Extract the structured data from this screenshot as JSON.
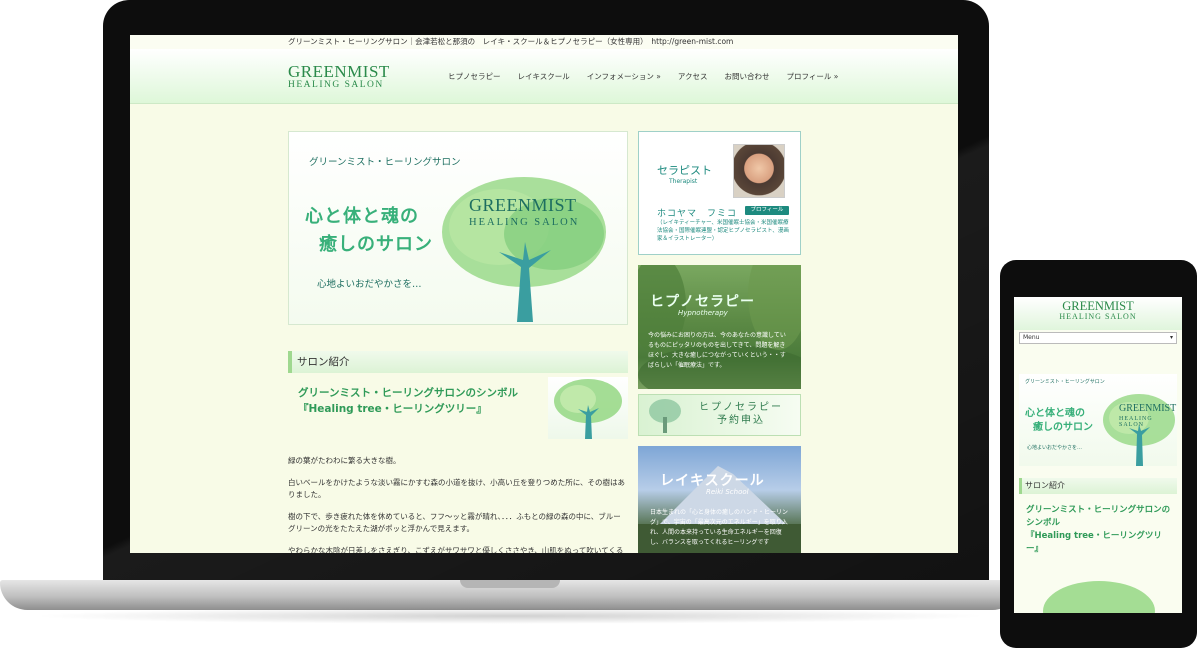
{
  "site": {
    "topline": "グリーンミスト・ヒーリングサロン｜会津若松と那須の　レイキ・スクール＆ヒプノセラピー（女性専用）　http://green-mist.com",
    "logo": {
      "line1": "GREENMIST",
      "line2": "HEALING   SALON"
    },
    "nav": [
      {
        "label": "ヒプノセラピー",
        "dropdown": false
      },
      {
        "label": "レイキスクール",
        "dropdown": false
      },
      {
        "label": "インフォメーション »",
        "dropdown": true
      },
      {
        "label": "アクセス",
        "dropdown": false
      },
      {
        "label": "お問い合わせ",
        "dropdown": false
      },
      {
        "label": "プロフィール »",
        "dropdown": true
      }
    ],
    "hero": {
      "subtitle": "グリーンミスト・ヒーリングサロン",
      "catch_line1": "心と体と魂の",
      "catch_line2": "癒しのサロン",
      "tagline": "心地よいおだやかさを…",
      "logo_line1": "GREENMIST",
      "logo_line2": "HEALING   SALON"
    },
    "section_title": "サロン紹介",
    "intro_title_line1": "グリーンミスト・ヒーリングサロンのシンボル",
    "intro_title_line2": "『Healing tree・ヒーリングツリー』",
    "paragraphs": [
      "緑の葉がたわわに繁る大きな樹。",
      "白いベールをかけたような淡い霧にかすむ森の小道を抜け、小高い丘を登りつめた所に、その樹はありました。",
      "樹の下で、歩き疲れた体を休めていると、フフ〜ッと霧が晴れ、．．．ふもとの緑の森の中に、ブルーグリーンの光をたたえた湖がポッと浮かんで見えます。",
      "やわらかな木陰が日差しをさえぎり、こずえがサワサワと優しくささやき、山肌をぬって吹いてくる風がほ"
    ],
    "sidebar": {
      "profile": {
        "heading": "セラピスト",
        "heading_en": "Therapist",
        "name": "ホコヤマ　フミコ",
        "button": "プロフィール",
        "desc": "（レイキティーチャー、米国催眠士協会・米国催眠療法協会・国際催眠連盟・認定ヒプノセラピスト、漫画家＆イラストレーター）"
      },
      "hypno": {
        "title": "ヒプノセラピー",
        "subtitle": "Hypnotherapy",
        "desc": "今の悩みにお困りの方は、今のあなたの意識しているものにピッタリのものを出してきて、問題を解きほぐし、大きな癒しにつながっていくという・・すばらしい「催眠療法」です。"
      },
      "reserve": {
        "line1": "ヒプノセラピー",
        "line2": "予約申込"
      },
      "reiki": {
        "title": "レイキスクール",
        "subtitle": "Reiki School",
        "desc": "日本生まれの「心と身体の癒しのハンド・ヒーリング」で、宇宙の「最高次元のエネルギー」を取り入れ、人間の本来持っている生命エネルギーを回復し、バランスを取ってくれるヒーリングです"
      }
    }
  },
  "mobile": {
    "logo": {
      "line1": "GREENMIST",
      "line2": "HEALING   SALON"
    },
    "menu": "Menu",
    "hero_subtitle": "グリーンミスト・ヒーリングサロン",
    "catch_line1": "心と体と魂の",
    "catch_line2": "癒しのサロン",
    "tagline": "心地よいおだやかさを…",
    "hero_logo_line1": "GREENMIST",
    "hero_logo_line2": "HEALING   SALON",
    "section_title": "サロン紹介",
    "intro_line1": "グリーンミスト・ヒーリングサロンの",
    "intro_line2": "シンボル",
    "intro_line3": "『Healing tree・ヒーリングツリ",
    "intro_line4": "ー』"
  },
  "colors": {
    "accent": "#2f9a58",
    "teal": "#1d8a7f",
    "header_bg": "#def7d9",
    "page_bg": "#f8fbe7"
  }
}
